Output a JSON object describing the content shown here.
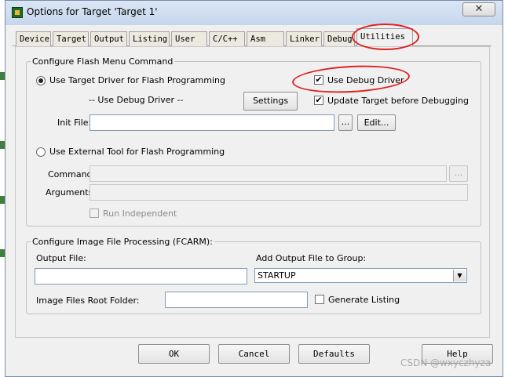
{
  "window": {
    "title": "Options for Target 'Target 1'",
    "close_label": "✕"
  },
  "tabs": [
    {
      "label": "Device"
    },
    {
      "label": "Target"
    },
    {
      "label": "Output"
    },
    {
      "label": "Listing"
    },
    {
      "label": "User"
    },
    {
      "label": "C/C++"
    },
    {
      "label": "Asm"
    },
    {
      "label": "Linker"
    },
    {
      "label": "Debug"
    },
    {
      "label": "Utilities",
      "active": true
    }
  ],
  "flash_group": {
    "legend": "Configure Flash Menu Command",
    "use_target_driver_label": "Use Target Driver for Flash Programming",
    "use_target_driver_selected": true,
    "use_debug_driver_label": "Use Debug Driver",
    "use_debug_driver_checked": true,
    "driver_name": "-- Use Debug Driver --",
    "settings_button": "Settings",
    "update_target_label": "Update Target before Debugging",
    "update_target_checked": true,
    "init_file_label": "Init File:",
    "init_file_value": "",
    "browse_button": "...",
    "edit_button": "Edit...",
    "use_external_tool_label": "Use External Tool for Flash Programming",
    "use_external_tool_selected": false,
    "command_label": "Command:",
    "command_value": "",
    "command_browse_button": "...",
    "arguments_label": "Arguments:",
    "arguments_value": "",
    "run_independent_label": "Run Independent",
    "run_independent_checked": false
  },
  "image_group": {
    "legend": "Configure Image File Processing (FCARM):",
    "output_file_label": "Output File:",
    "output_file_value": "",
    "add_output_label": "Add Output File  to Group:",
    "group_select_value": "STARTUP",
    "root_folder_label": "Image Files Root Folder:",
    "root_folder_value": "",
    "generate_listing_label": "Generate Listing",
    "generate_listing_checked": false
  },
  "footer": {
    "ok_button": "OK",
    "cancel_button": "Cancel",
    "defaults_button": "Defaults",
    "help_button": "Help"
  },
  "watermark": "CSDN @wxyczhyza",
  "annotation_color": "#e02020"
}
